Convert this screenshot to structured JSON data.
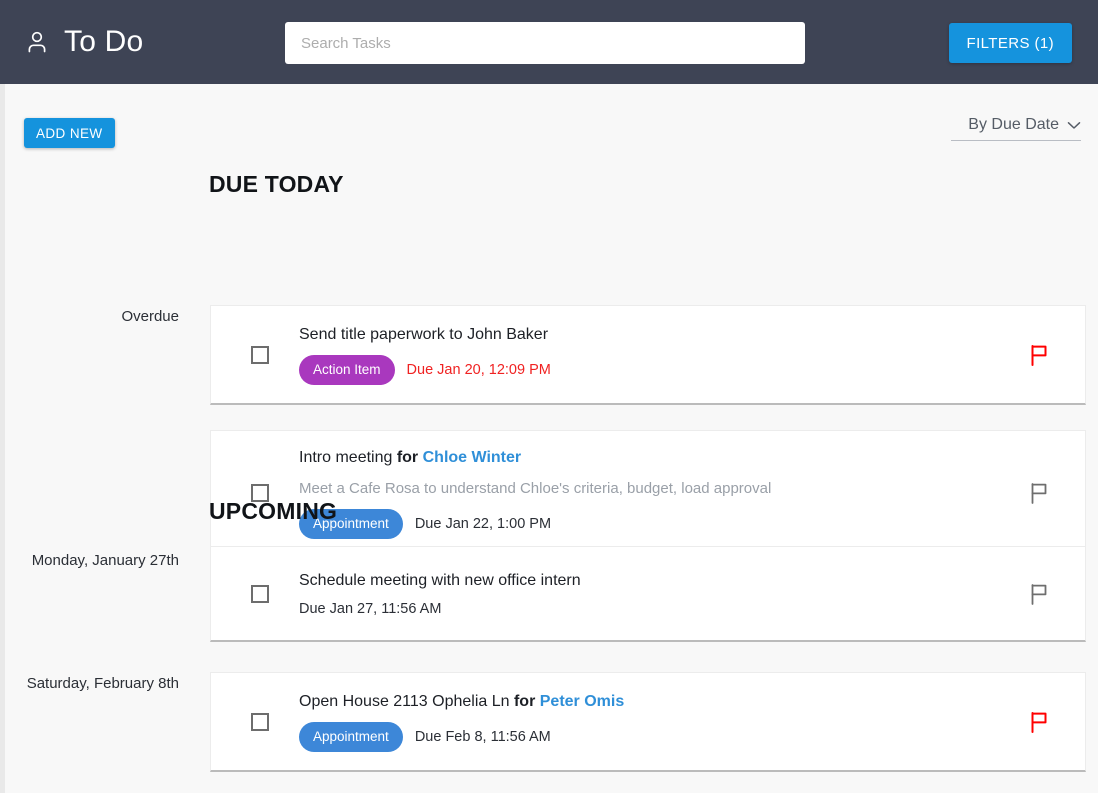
{
  "header": {
    "brand_icon": "person-icon",
    "title": "To Do",
    "search": {
      "placeholder": "Search Tasks",
      "value": ""
    },
    "filters_button": "FILTERS (1)",
    "background_color": "#3e4455",
    "accent_color": "#1593dd"
  },
  "toolbar": {
    "add_new_label": "ADD NEW",
    "sort_label": "By Due Date",
    "sort_icon": "chevron-down-icon"
  },
  "sections": [
    {
      "title": "DUE TODAY",
      "tasks": [
        {
          "group_label": "Overdue",
          "checked": false,
          "title_prefix": "Send title paperwork to John Baker",
          "link_text": "",
          "description": "",
          "badge": {
            "label": "Action Item",
            "color": "#a938be"
          },
          "due_text": "Due Jan 20, 12:09 PM",
          "due_overdue": true,
          "flag": {
            "state": "flagged",
            "color": "#ff0000"
          }
        },
        {
          "group_label": "",
          "checked": false,
          "title_prefix": "Intro meeting ",
          "title_for": "for ",
          "link_text": "Chloe Winter",
          "description": "Meet a Cafe Rosa to understand Chloe's criteria, budget, load approval",
          "badge": {
            "label": "Appointment",
            "color": "#3d87d8"
          },
          "due_text": "Due Jan 22, 1:00 PM",
          "due_overdue": false,
          "flag": {
            "state": "unflagged",
            "color": "#6e6e6e"
          }
        }
      ]
    },
    {
      "title": "UPCOMING",
      "tasks": [
        {
          "group_label": "Monday, January 27th",
          "checked": false,
          "title_prefix": "Schedule meeting with new office intern",
          "link_text": "",
          "description": "",
          "badge": null,
          "due_text": "Due Jan 27, 11:56 AM",
          "due_overdue": false,
          "flag": {
            "state": "unflagged",
            "color": "#6e6e6e"
          }
        },
        {
          "group_label": "Saturday, February 8th",
          "checked": false,
          "title_prefix": "Open House 2113 Ophelia Ln ",
          "title_for": "for ",
          "link_text": "Peter Omis",
          "description": "",
          "badge": {
            "label": "Appointment",
            "color": "#3d87d8"
          },
          "due_text": "Due Feb 8, 11:56 AM",
          "due_overdue": false,
          "flag": {
            "state": "flagged",
            "color": "#ff0000"
          }
        }
      ]
    }
  ]
}
